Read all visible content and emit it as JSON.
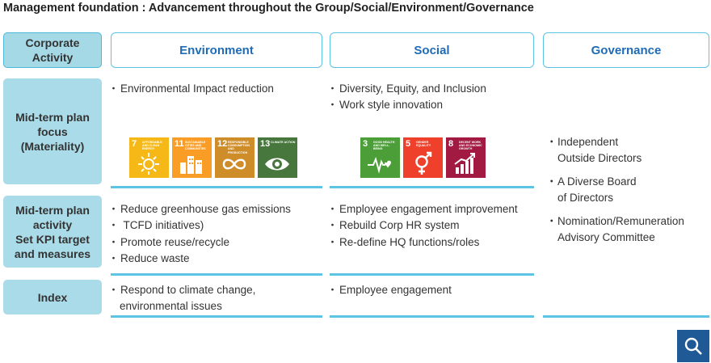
{
  "title": "Management foundation : Advancement throughout the Group/Social/Environment/Governance",
  "row_headers": {
    "corporate": "Corporate\nActivity",
    "focus": "Mid-term plan\nfocus\n(Materiality)",
    "kpi": "Mid-term plan\nactivity\nSet KPI target\nand measures",
    "index": "Index"
  },
  "columns": {
    "environment": "Environment",
    "social": "Social",
    "governance": "Governance"
  },
  "environment": {
    "focus": [
      "Environmental Impact reduction"
    ],
    "kpi": [
      "Reduce greenhouse gas emissions",
      "(TCFD initiatives)",
      "Promote reuse/recycle",
      "Reduce waste"
    ],
    "index": [
      "Respond to climate change,",
      "environmental issues"
    ],
    "sdgs": [
      {
        "num": "7",
        "caption": "Affordable and clean energy",
        "color": "#f5b817",
        "icon": "sun-icon"
      },
      {
        "num": "11",
        "caption": "Sustainable cities and communities",
        "color": "#f99d26",
        "icon": "city-icon"
      },
      {
        "num": "12",
        "caption": "Responsible consumption and production",
        "color": "#cf8d2a",
        "icon": "infinity-icon"
      },
      {
        "num": "13",
        "caption": "Climate action",
        "color": "#48773e",
        "icon": "eye-globe-icon"
      }
    ]
  },
  "social": {
    "focus": [
      "Diversity, Equity, and Inclusion",
      "Work style innovation"
    ],
    "kpi": [
      "Employee engagement improvement",
      "Rebuild Corp HR system",
      "Re-define HQ functions/roles"
    ],
    "index": [
      "Employee engagement"
    ],
    "sdgs": [
      {
        "num": "3",
        "caption": "Good health and well-being",
        "color": "#4c9f38",
        "icon": "heartbeat-icon"
      },
      {
        "num": "5",
        "caption": "Gender equality",
        "color": "#ef402b",
        "icon": "gender-icon"
      },
      {
        "num": "8",
        "caption": "Decent work and economic growth",
        "color": "#a21942",
        "icon": "growth-chart-icon"
      }
    ]
  },
  "governance": {
    "items": [
      "Independent\nOutside Directors",
      "A Diverse Board\nof Directors",
      "Nomination/Remuneration\nAdvisory Committee"
    ]
  }
}
